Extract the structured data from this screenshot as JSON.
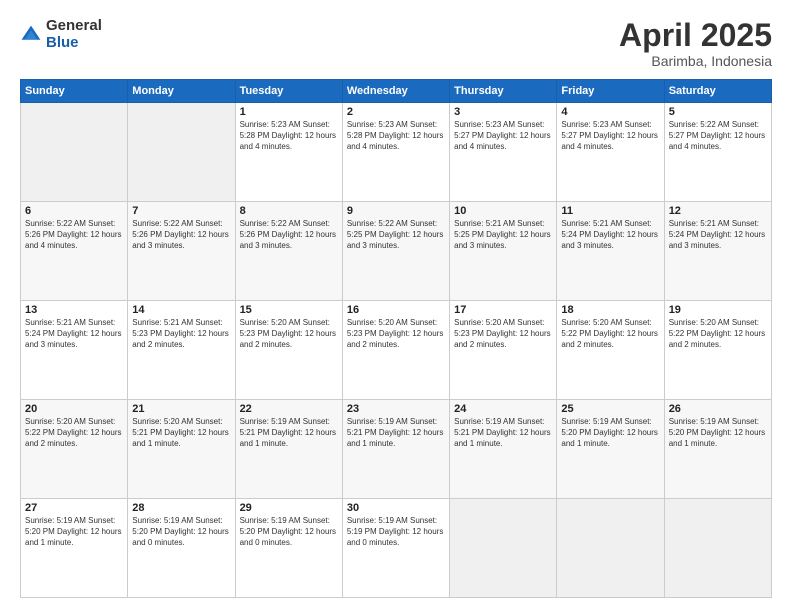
{
  "logo": {
    "general": "General",
    "blue": "Blue"
  },
  "title": {
    "month": "April 2025",
    "location": "Barimba, Indonesia"
  },
  "days_header": [
    "Sunday",
    "Monday",
    "Tuesday",
    "Wednesday",
    "Thursday",
    "Friday",
    "Saturday"
  ],
  "weeks": [
    [
      {
        "day": "",
        "detail": ""
      },
      {
        "day": "",
        "detail": ""
      },
      {
        "day": "1",
        "detail": "Sunrise: 5:23 AM\nSunset: 5:28 PM\nDaylight: 12 hours\nand 4 minutes."
      },
      {
        "day": "2",
        "detail": "Sunrise: 5:23 AM\nSunset: 5:28 PM\nDaylight: 12 hours\nand 4 minutes."
      },
      {
        "day": "3",
        "detail": "Sunrise: 5:23 AM\nSunset: 5:27 PM\nDaylight: 12 hours\nand 4 minutes."
      },
      {
        "day": "4",
        "detail": "Sunrise: 5:23 AM\nSunset: 5:27 PM\nDaylight: 12 hours\nand 4 minutes."
      },
      {
        "day": "5",
        "detail": "Sunrise: 5:22 AM\nSunset: 5:27 PM\nDaylight: 12 hours\nand 4 minutes."
      }
    ],
    [
      {
        "day": "6",
        "detail": "Sunrise: 5:22 AM\nSunset: 5:26 PM\nDaylight: 12 hours\nand 4 minutes."
      },
      {
        "day": "7",
        "detail": "Sunrise: 5:22 AM\nSunset: 5:26 PM\nDaylight: 12 hours\nand 3 minutes."
      },
      {
        "day": "8",
        "detail": "Sunrise: 5:22 AM\nSunset: 5:26 PM\nDaylight: 12 hours\nand 3 minutes."
      },
      {
        "day": "9",
        "detail": "Sunrise: 5:22 AM\nSunset: 5:25 PM\nDaylight: 12 hours\nand 3 minutes."
      },
      {
        "day": "10",
        "detail": "Sunrise: 5:21 AM\nSunset: 5:25 PM\nDaylight: 12 hours\nand 3 minutes."
      },
      {
        "day": "11",
        "detail": "Sunrise: 5:21 AM\nSunset: 5:24 PM\nDaylight: 12 hours\nand 3 minutes."
      },
      {
        "day": "12",
        "detail": "Sunrise: 5:21 AM\nSunset: 5:24 PM\nDaylight: 12 hours\nand 3 minutes."
      }
    ],
    [
      {
        "day": "13",
        "detail": "Sunrise: 5:21 AM\nSunset: 5:24 PM\nDaylight: 12 hours\nand 3 minutes."
      },
      {
        "day": "14",
        "detail": "Sunrise: 5:21 AM\nSunset: 5:23 PM\nDaylight: 12 hours\nand 2 minutes."
      },
      {
        "day": "15",
        "detail": "Sunrise: 5:20 AM\nSunset: 5:23 PM\nDaylight: 12 hours\nand 2 minutes."
      },
      {
        "day": "16",
        "detail": "Sunrise: 5:20 AM\nSunset: 5:23 PM\nDaylight: 12 hours\nand 2 minutes."
      },
      {
        "day": "17",
        "detail": "Sunrise: 5:20 AM\nSunset: 5:23 PM\nDaylight: 12 hours\nand 2 minutes."
      },
      {
        "day": "18",
        "detail": "Sunrise: 5:20 AM\nSunset: 5:22 PM\nDaylight: 12 hours\nand 2 minutes."
      },
      {
        "day": "19",
        "detail": "Sunrise: 5:20 AM\nSunset: 5:22 PM\nDaylight: 12 hours\nand 2 minutes."
      }
    ],
    [
      {
        "day": "20",
        "detail": "Sunrise: 5:20 AM\nSunset: 5:22 PM\nDaylight: 12 hours\nand 2 minutes."
      },
      {
        "day": "21",
        "detail": "Sunrise: 5:20 AM\nSunset: 5:21 PM\nDaylight: 12 hours\nand 1 minute."
      },
      {
        "day": "22",
        "detail": "Sunrise: 5:19 AM\nSunset: 5:21 PM\nDaylight: 12 hours\nand 1 minute."
      },
      {
        "day": "23",
        "detail": "Sunrise: 5:19 AM\nSunset: 5:21 PM\nDaylight: 12 hours\nand 1 minute."
      },
      {
        "day": "24",
        "detail": "Sunrise: 5:19 AM\nSunset: 5:21 PM\nDaylight: 12 hours\nand 1 minute."
      },
      {
        "day": "25",
        "detail": "Sunrise: 5:19 AM\nSunset: 5:20 PM\nDaylight: 12 hours\nand 1 minute."
      },
      {
        "day": "26",
        "detail": "Sunrise: 5:19 AM\nSunset: 5:20 PM\nDaylight: 12 hours\nand 1 minute."
      }
    ],
    [
      {
        "day": "27",
        "detail": "Sunrise: 5:19 AM\nSunset: 5:20 PM\nDaylight: 12 hours\nand 1 minute."
      },
      {
        "day": "28",
        "detail": "Sunrise: 5:19 AM\nSunset: 5:20 PM\nDaylight: 12 hours\nand 0 minutes."
      },
      {
        "day": "29",
        "detail": "Sunrise: 5:19 AM\nSunset: 5:20 PM\nDaylight: 12 hours\nand 0 minutes."
      },
      {
        "day": "30",
        "detail": "Sunrise: 5:19 AM\nSunset: 5:19 PM\nDaylight: 12 hours\nand 0 minutes."
      },
      {
        "day": "",
        "detail": ""
      },
      {
        "day": "",
        "detail": ""
      },
      {
        "day": "",
        "detail": ""
      }
    ]
  ]
}
